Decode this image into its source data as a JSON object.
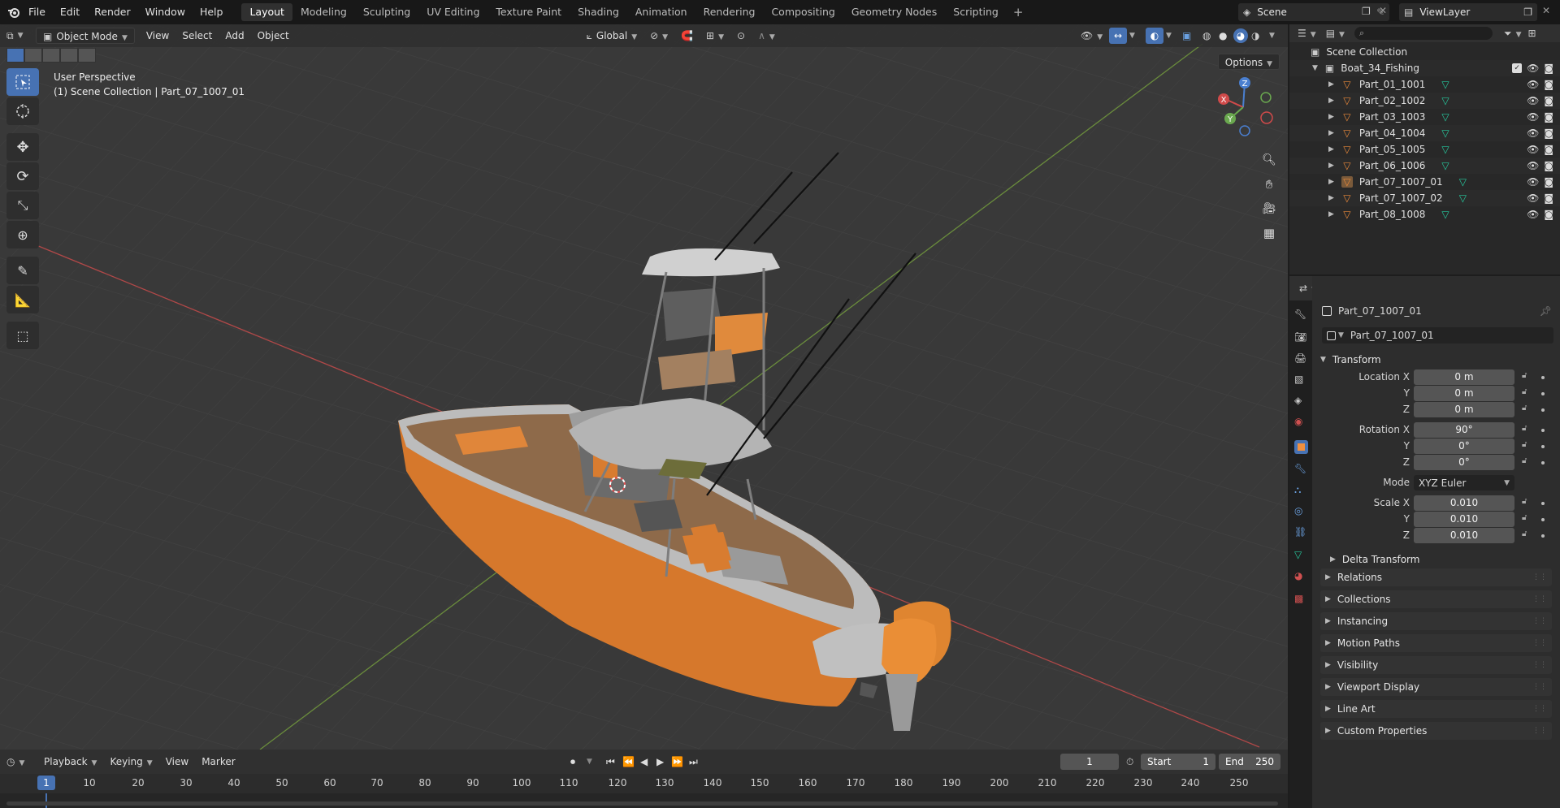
{
  "topbar": {
    "menus": [
      "File",
      "Edit",
      "Render",
      "Window",
      "Help"
    ],
    "workspaces": [
      "Layout",
      "Modeling",
      "Sculpting",
      "UV Editing",
      "Texture Paint",
      "Shading",
      "Animation",
      "Rendering",
      "Compositing",
      "Geometry Nodes",
      "Scripting"
    ],
    "active_workspace": "Layout",
    "add_workspace": "+",
    "scene": "Scene",
    "view_layer": "ViewLayer"
  },
  "viewport": {
    "mode": "Object Mode",
    "menus": [
      "View",
      "Select",
      "Add",
      "Object"
    ],
    "orientation": "Global",
    "options": "Options",
    "view_label": "User Perspective",
    "collection_label": "(1) Scene Collection | Part_07_1007_01",
    "gizmo": {
      "x": "X",
      "y": "Y",
      "z": "Z"
    }
  },
  "timeline": {
    "menus": [
      "Playback",
      "Keying",
      "View",
      "Marker"
    ],
    "current_frame": "1",
    "start_label": "Start",
    "start": "1",
    "end_label": "End",
    "end": "250",
    "ticks": [
      "1",
      "10",
      "20",
      "30",
      "40",
      "50",
      "60",
      "70",
      "80",
      "90",
      "100",
      "110",
      "120",
      "130",
      "140",
      "150",
      "160",
      "170",
      "180",
      "190",
      "200",
      "210",
      "220",
      "230",
      "240",
      "250"
    ]
  },
  "outliner": {
    "root": "Scene Collection",
    "collection": "Boat_34_Fishing",
    "items": [
      "Part_01_1001",
      "Part_02_1002",
      "Part_03_1003",
      "Part_04_1004",
      "Part_05_1005",
      "Part_06_1006",
      "Part_07_1007_01",
      "Part_07_1007_02",
      "Part_08_1008"
    ],
    "selected": "Part_07_1007_01"
  },
  "properties": {
    "object_name": "Part_07_1007_01",
    "datablock": "Part_07_1007_01",
    "transform": {
      "title": "Transform",
      "location_label": "Location X",
      "location": [
        "0 m",
        "0 m",
        "0 m"
      ],
      "rotation_label": "Rotation X",
      "rotation": [
        "90°",
        "0°",
        "0°"
      ],
      "mode_label": "Mode",
      "mode": "XYZ Euler",
      "scale_label": "Scale X",
      "scale": [
        "0.010",
        "0.010",
        "0.010"
      ],
      "axis_y": "Y",
      "axis_z": "Z",
      "delta": "Delta Transform"
    },
    "panels": [
      "Relations",
      "Collections",
      "Instancing",
      "Motion Paths",
      "Visibility",
      "Viewport Display",
      "Line Art",
      "Custom Properties"
    ]
  },
  "colors": {
    "accent": "#4772b3",
    "orange_icon": "#e8883a",
    "mesh_icon": "#27c99e"
  }
}
